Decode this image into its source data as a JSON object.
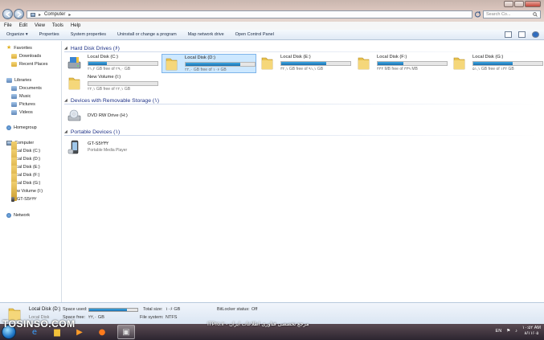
{
  "window": {
    "address": [
      "Computer"
    ],
    "search_placeholder": "Search Co..."
  },
  "menu": [
    "File",
    "Edit",
    "View",
    "Tools",
    "Help"
  ],
  "toolbar": {
    "items": [
      "Organize ▾",
      "Properties",
      "System properties",
      "Uninstall or change a program",
      "Map network drive",
      "Open Control Panel"
    ]
  },
  "sidebar": {
    "favorites": {
      "label": "Favorites",
      "items": [
        "Downloads",
        "Recent Places"
      ]
    },
    "libraries": {
      "label": "Libraries",
      "items": [
        "Documents",
        "Music",
        "Pictures",
        "Videos"
      ]
    },
    "homegroup": "Homegroup",
    "computer": {
      "label": "Computer",
      "items": [
        "Local Disk (C:)",
        "Local Disk (D:)",
        "Local Disk (E:)",
        "Local Disk (F:)",
        "Local Disk (G:)",
        "New Volume (I:)",
        "GT-S5۲۳۲"
      ]
    },
    "network": "Network"
  },
  "groups": {
    "hdd": "Hard Disk Drives (۶)",
    "removable": "Devices with Removable Storage (۱)",
    "portable": "Portable Devices (۱)"
  },
  "drives": [
    {
      "name": "Local Disk (C:)",
      "free": "۲۱,۲ GB free of ۲۹,۰ GB",
      "used_fraction": 0.27
    },
    {
      "name": "Local Disk (D:)",
      "free": "۲۲,۰ GB free of ۱۰۶ GB",
      "used_fraction": 0.79
    },
    {
      "name": "Local Disk (E:)",
      "free": "۳۲,۱ GB free of ۹۱,۱ GB",
      "used_fraction": 0.65
    },
    {
      "name": "Local Disk (F:)",
      "free": "۴۴۴ MB free of ۳۳۹ MB",
      "used_fraction": 0.37
    },
    {
      "name": "Local Disk (G:)",
      "free": "۵۱,۱ GB free of ۱۳۲ GB",
      "used_fraction": 0.57
    },
    {
      "name": "New Volume (I:)",
      "free": "۲۲,۱ GB free of ۲۲,۱ GB",
      "used_fraction": 0.0
    }
  ],
  "removable": [
    {
      "name": "DVD RW Drive (H:)"
    }
  ],
  "portable": [
    {
      "name": "GT-S5۲۳۲",
      "type": "Portable Media Player"
    }
  ],
  "details": {
    "name": "Local Disk (D:)",
    "type": "Local Disk",
    "space_used_label": "Space used:",
    "space_free_label": "Space free:",
    "space_free": "۲۲,۰ GB",
    "total_size_label": "Total size:",
    "total_size": "۱۰۶ GB",
    "fs_label": "File system:",
    "fs": "NTFS",
    "bitlocker_label": "BitLocker status:",
    "bitlocker": "Off",
    "used_fraction": 0.79
  },
  "taskbar": {
    "lang": "EN",
    "time": "۱۰:۵۲ AM",
    "date": "۸/۱۱/۰۵"
  },
  "watermarks": {
    "left": "TOSINSO.COM",
    "right": "ITPro.ir - مرجع تخصصی فناوری اطلاعات ایران"
  },
  "colors": {
    "bar_fill": "#1b6fae",
    "group_header": "#1e3287",
    "selection": "#cde8ff"
  }
}
